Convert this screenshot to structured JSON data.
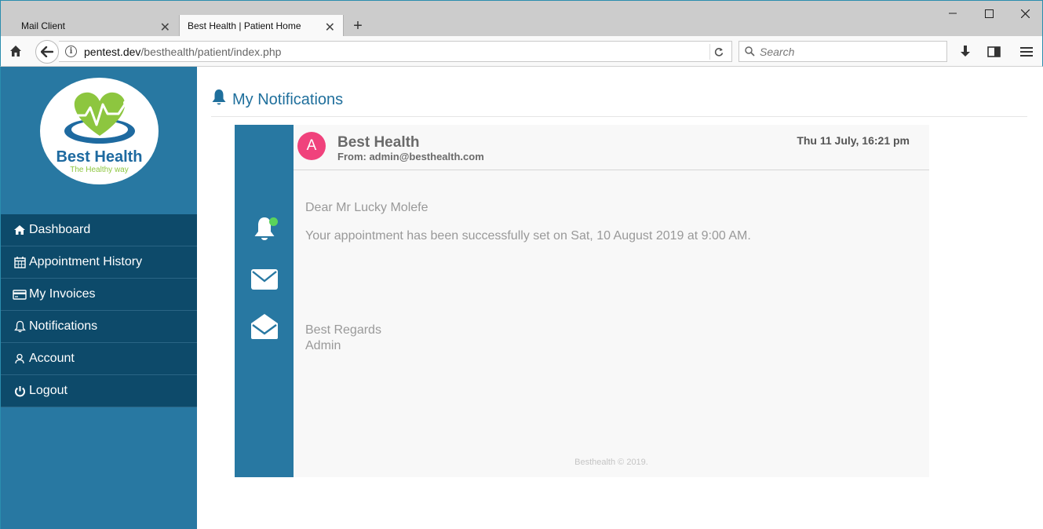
{
  "browser": {
    "tabs": [
      {
        "label": "Mail Client"
      },
      {
        "label": "Best Health | Patient Home"
      }
    ],
    "url_domain": "pentest.dev",
    "url_path": "/besthealth/patient/index.php",
    "search_placeholder": "Search"
  },
  "logo": {
    "brand": "Best Health",
    "tagline": "The Healthy way"
  },
  "sidebar": {
    "items": [
      {
        "label": "Dashboard",
        "icon": "home-icon"
      },
      {
        "label": "Appointment History",
        "icon": "calendar-icon"
      },
      {
        "label": "My Invoices",
        "icon": "credit-card-icon"
      },
      {
        "label": "Notifications",
        "icon": "bell-icon"
      },
      {
        "label": "Account",
        "icon": "user-icon"
      },
      {
        "label": "Logout",
        "icon": "power-icon"
      }
    ]
  },
  "main": {
    "title": "My Notifications"
  },
  "message": {
    "avatar_letter": "A",
    "sender": "Best Health",
    "from": "From: admin@besthealth.com",
    "date": "Thu 11 July, 16:21 pm",
    "greeting": "Dear Mr Lucky Molefe",
    "body": "Your appointment has been successfully set on Sat, 10 August 2019 at 9:00 AM.",
    "signoff": "Best Regards",
    "signature": "Admin",
    "footer": "Besthealth © 2019."
  },
  "colors": {
    "sidebar": "#2878a2",
    "menu_item": "#0d4a6a",
    "title": "#1f6f9c",
    "avatar": "#f0427c",
    "status_dot": "#5bd35b"
  }
}
